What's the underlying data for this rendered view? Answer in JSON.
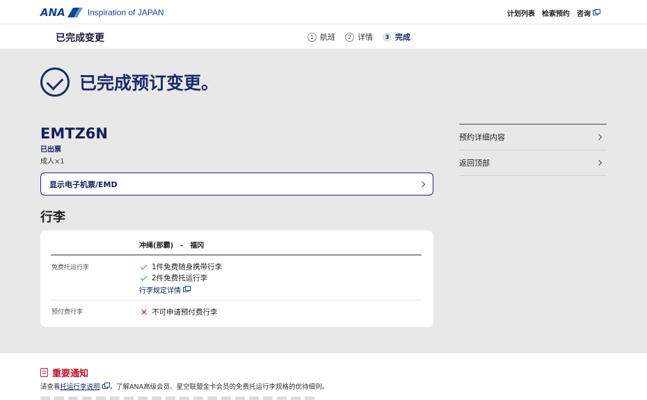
{
  "header": {
    "logo": "ANA",
    "tagline": "Inspiration of JAPAN",
    "nav": [
      "计划列表",
      "检索预约",
      "咨询"
    ]
  },
  "stepbar": {
    "title": "已完成变更",
    "steps": [
      {
        "num": "1",
        "label": "航班"
      },
      {
        "num": "2",
        "label": "详情"
      },
      {
        "num": "3",
        "label": "完成"
      }
    ]
  },
  "main": {
    "done_message": "已完成预订变更。",
    "pnr": "EMTZ6N",
    "ticket_status": "已出票",
    "passengers": "成人×1",
    "eticket_button": "显示电子机票/EMD"
  },
  "baggage": {
    "title": "行李",
    "route": "冲绳(那霸)　-　福冈",
    "free_label": "免费托运行李",
    "free_items": [
      "1件免费随身携带行李",
      "2件免费托运行李"
    ],
    "rule_link": "行李规定详情",
    "prepaid_label": "预付费行李",
    "prepaid_text": "不可申请预付费行李"
  },
  "side": {
    "items": [
      "预约详细内容",
      "返回顶部"
    ]
  },
  "notice": {
    "title": "重要通知",
    "text_before": "请查看",
    "link": "托运行李说明",
    "text_after": "，了解ANA高级会员、星空联盟金卡会员的免费托运行李规格的优待细则。"
  },
  "colors": {
    "brand": "#13448f",
    "accent": "#1b2a6b",
    "alert": "#c8102e",
    "check": "#27a04a",
    "background": "#e8e8e8"
  }
}
